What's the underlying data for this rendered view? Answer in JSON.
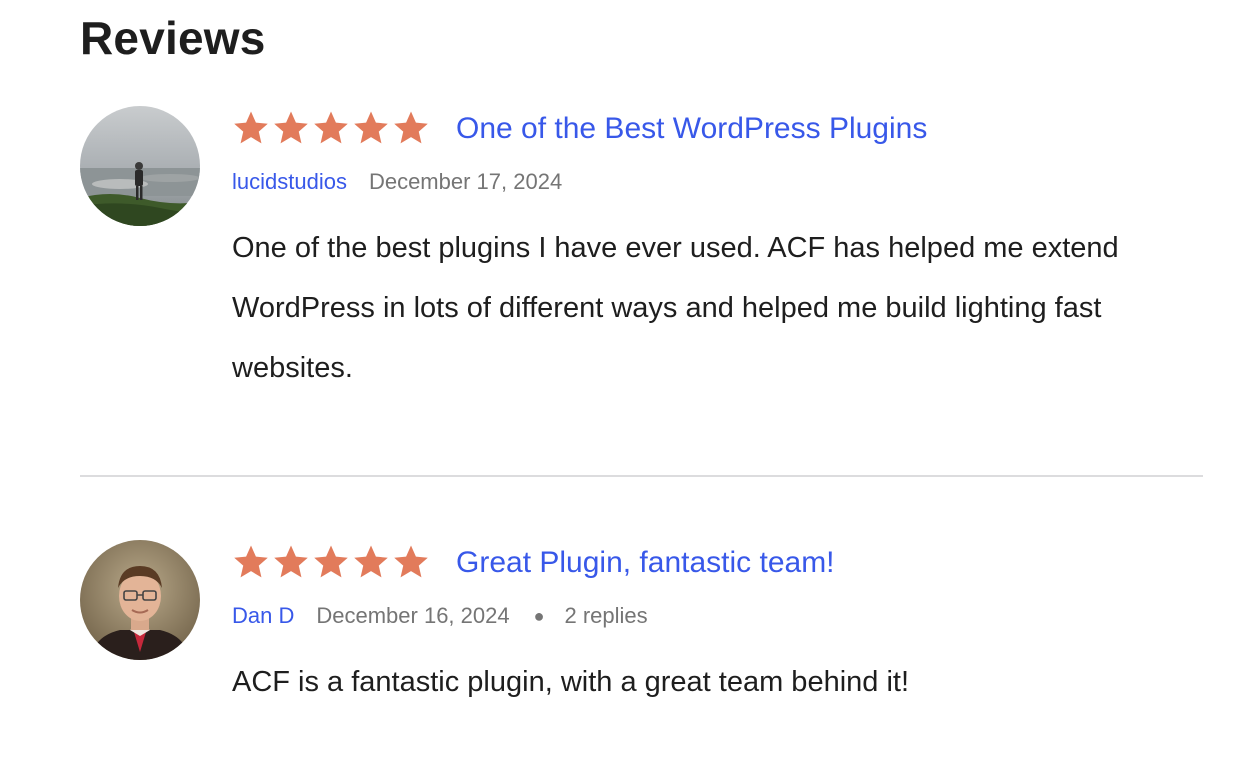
{
  "page": {
    "heading": "Reviews"
  },
  "colors": {
    "star": "#e27b5b",
    "link": "#3858e9",
    "muted": "#757575",
    "text": "#1e1e1e",
    "divider": "#dcdcde"
  },
  "reviews": [
    {
      "rating": 5,
      "rating_max": 5,
      "title": "One of the Best WordPress Plugins",
      "author": "lucidstudios",
      "date": "December 17, 2024",
      "replies": "",
      "body": "One of the best plugins I have ever used. ACF has helped me extend WordPress in lots of different ways and helped me build lighting fast websites.",
      "avatar_icon": "avatar-photo-landscape"
    },
    {
      "rating": 5,
      "rating_max": 5,
      "title": "Great Plugin, fantastic team!",
      "author": "Dan D",
      "date": "December 16, 2024",
      "replies": "2 replies",
      "body": "ACF is a fantastic plugin, with a great team behind it!",
      "avatar_icon": "avatar-photo-portrait"
    }
  ]
}
